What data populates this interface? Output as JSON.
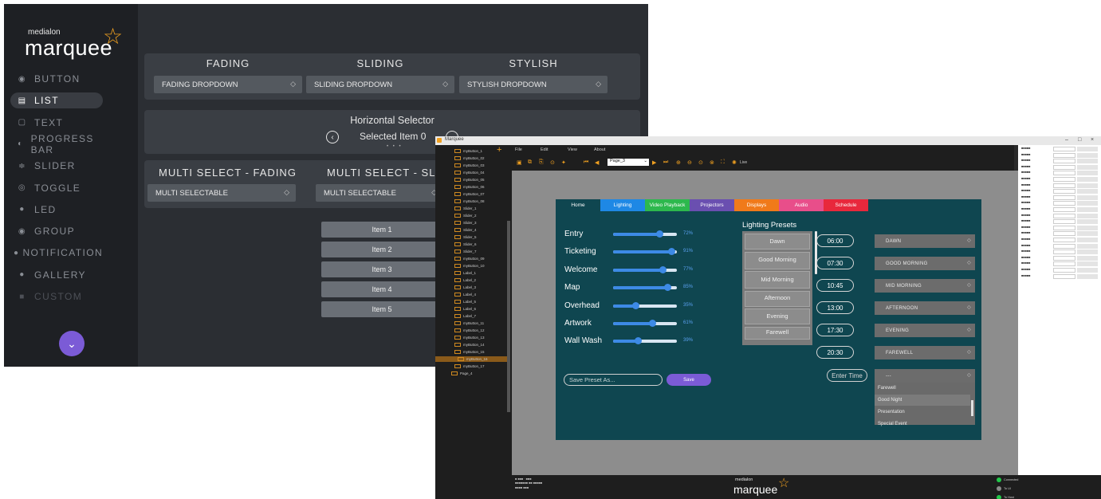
{
  "showcase": {
    "logo_small": "medialon",
    "logo_big": "marquee",
    "nav": [
      {
        "label": "BUTTON",
        "icon": "◉"
      },
      {
        "label": "LIST",
        "icon": "▤"
      },
      {
        "label": "TEXT",
        "icon": "▢"
      },
      {
        "label": "PROGRESS BAR",
        "icon": "◐"
      },
      {
        "label": "SLIDER",
        "icon": "≑"
      },
      {
        "label": "TOGGLE",
        "icon": "◎"
      },
      {
        "label": "LED",
        "icon": "●"
      },
      {
        "label": "GROUP",
        "icon": "◉"
      },
      {
        "label": "NOTIFICATION",
        "icon": "●"
      },
      {
        "label": "GALLERY",
        "icon": "●"
      },
      {
        "label": "CUSTOM",
        "icon": "■"
      }
    ],
    "columns": [
      {
        "title": "FADING",
        "dropdown": "FADING DROPDOWN"
      },
      {
        "title": "SLIDING",
        "dropdown": "SLIDING DROPDOWN"
      },
      {
        "title": "STYLISH",
        "dropdown": "STYLISH DROPDOWN"
      }
    ],
    "horizontal_selector": {
      "title": "Horizontal Selector",
      "value": "Selected Item 0"
    },
    "multi": [
      {
        "title": "MULTI SELECT - FADING",
        "dropdown": "MULTI SELECTABLE"
      },
      {
        "title": "MULTI SELECT - SLID",
        "dropdown": "MULTI SELECTABLE"
      }
    ],
    "list_items": [
      "Item 1",
      "Item 2",
      "Item 3",
      "Item 4",
      "Item 5"
    ]
  },
  "designer": {
    "window_title": "Marquee",
    "menu": [
      "File",
      "Edit",
      "View",
      "About"
    ],
    "page_selector": "Page_3",
    "live_label": "Live",
    "tree_items": [
      "myButton_1",
      "myButton_02",
      "myButton_03",
      "myButton_04",
      "myButton_05",
      "myButton_06",
      "myButton_07",
      "myButton_08",
      "Slider_1",
      "Slider_2",
      "Slider_3",
      "Slider_4",
      "Slider_5",
      "Slider_6",
      "Slider_7",
      "myButton_09",
      "myButton_10",
      "Label_1",
      "Label_2",
      "Label_3",
      "Label_4",
      "Label_5",
      "Label_6",
      "Label_7",
      "myButton_11",
      "myButton_12",
      "myButton_13",
      "myButton_14",
      "myButton_15",
      "myButton_16",
      "myButton_17",
      "Page_4"
    ],
    "tabs": [
      {
        "label": "Home",
        "color": "#0f4650"
      },
      {
        "label": "Lighting",
        "color": "#1e88e5"
      },
      {
        "label": "Video Playback",
        "color": "#2db84d"
      },
      {
        "label": "Projectors",
        "color": "#6a4fb0"
      },
      {
        "label": "Displays",
        "color": "#f07a1a"
      },
      {
        "label": "Audio",
        "color": "#e84e8a"
      },
      {
        "label": "Schedule",
        "color": "#e8283c"
      }
    ],
    "sliders": [
      {
        "label": "Entry",
        "value": 72,
        "text": "72%"
      },
      {
        "label": "Ticketing",
        "value": 91,
        "text": "91%"
      },
      {
        "label": "Welcome",
        "value": 77,
        "text": "77%"
      },
      {
        "label": "Map",
        "value": 85,
        "text": "85%"
      },
      {
        "label": "Overhead",
        "value": 35,
        "text": "35%"
      },
      {
        "label": "Artwork",
        "value": 61,
        "text": "61%"
      },
      {
        "label": "Wall Wash",
        "value": 39,
        "text": "39%"
      }
    ],
    "presets_title": "Lighting Presets",
    "presets": [
      "Dawn",
      "Good Morning",
      "Mid Morning",
      "Afternoon",
      "Evening",
      "Farewell"
    ],
    "schedule": [
      {
        "time": "06:00",
        "preset": "DAWN"
      },
      {
        "time": "07:30",
        "preset": "GOOD MORNING"
      },
      {
        "time": "10:45",
        "preset": "MID MORNING"
      },
      {
        "time": "13:00",
        "preset": "AFTERNOON"
      },
      {
        "time": "17:30",
        "preset": "EVENING"
      },
      {
        "time": "20:30",
        "preset": "FAREWELL"
      }
    ],
    "enter_time_placeholder": "Enter Time",
    "open_dropdown_value": "---",
    "open_dropdown_options": [
      "Farewell",
      "Good Night",
      "Presentation",
      "Special Event"
    ],
    "save_placeholder": "Save Preset As...",
    "save_label": "Save",
    "footer_logo_small": "medialon",
    "footer_logo_big": "marquee",
    "status": [
      "Connected",
      "To UI",
      "To Host"
    ]
  }
}
